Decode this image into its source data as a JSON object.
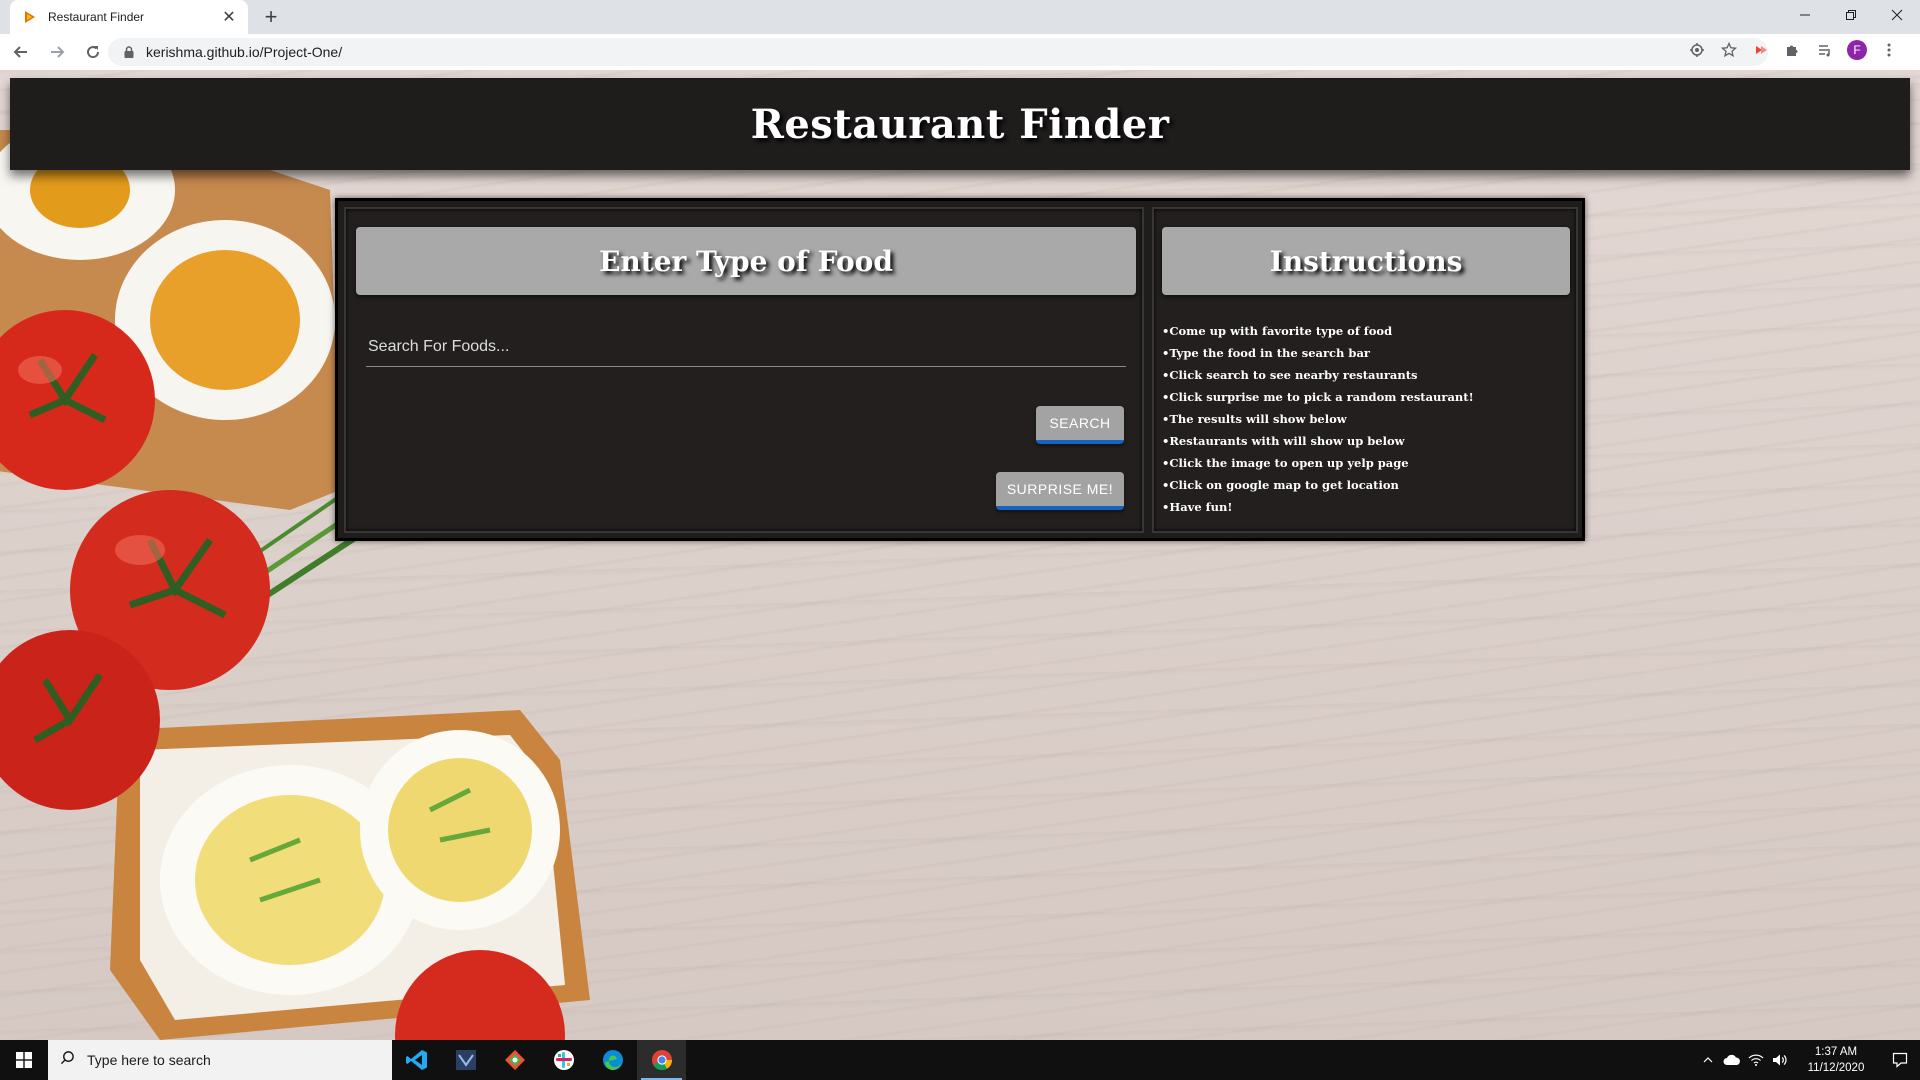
{
  "browser": {
    "tab_title": "Restaurant Finder",
    "tab_close": "✕",
    "new_tab": "+",
    "url": "kerishma.github.io/Project-One/",
    "profile_initial": "F",
    "icons": [
      "location-icon",
      "star-icon",
      "extension-icon",
      "puzzle-icon",
      "media-icon"
    ]
  },
  "page": {
    "site_title": "Restaurant Finder",
    "search_panel": {
      "heading": "Enter Type of Food",
      "input_placeholder": "Search For Foods...",
      "search_button": "Search",
      "surprise_button": "Surprise Me!"
    },
    "instructions_panel": {
      "heading": "Instructions",
      "items": [
        "•Come up with favorite type of food",
        "•Type the food in the search bar",
        "•Click search to see nearby restaurants",
        "•Click surprise me to pick a random restaurant!",
        "•The results will show below",
        "•Restaurants with will show up below",
        "•Click the image to open up yelp page",
        "•Click on google map to get location",
        "•Have fun!"
      ]
    },
    "colors": {
      "panel_bg": "#231f1f",
      "heading_bg": "#a9a9a9",
      "button_accent": "#1565c0"
    }
  },
  "taskbar": {
    "search_placeholder": "Type here to search",
    "apps": [
      "vscode-icon",
      "visual-studio-icon",
      "git-icon",
      "slack-icon",
      "edge-icon",
      "chrome-icon"
    ],
    "time": "1:37 AM",
    "date": "11/12/2020"
  }
}
